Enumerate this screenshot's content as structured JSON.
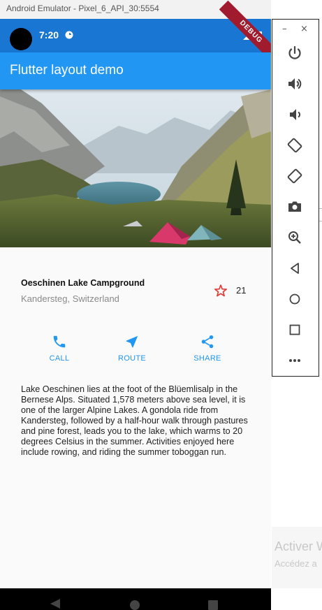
{
  "window": {
    "title": "Android Emulator - Pixel_6_API_30:5554"
  },
  "status_bar": {
    "time": "7:20",
    "debug_banner": "DEBUG"
  },
  "app_bar": {
    "title": "Flutter layout demo"
  },
  "place": {
    "title": "Oeschinen Lake Campground",
    "location": "Kandersteg, Switzerland",
    "favorite_count": "21"
  },
  "actions": [
    {
      "label": "CALL",
      "icon": "phone-icon"
    },
    {
      "label": "ROUTE",
      "icon": "navigation-icon"
    },
    {
      "label": "SHARE",
      "icon": "share-icon"
    }
  ],
  "description": "Lake Oeschinen lies at the foot of the Blüemlisalp in the Bernese Alps. Situated 1,578 meters above sea level, it is one of the larger Alpine Lakes. A gondola ride from Kandersteg, followed by a half-hour walk through pastures and pine forest, leads you to the lake, which warms to 20 degrees Celsius in the summer. Activities enjoyed here include rowing, and riding the summer toboggan run.",
  "emulator_toolbar": {
    "buttons": [
      "power-icon",
      "volume-up-icon",
      "volume-down-icon",
      "rotate-left-icon",
      "rotate-right-icon",
      "camera-icon",
      "zoom-icon",
      "back-icon",
      "home-icon",
      "overview-icon",
      "more-icon"
    ]
  },
  "background": {
    "activation_title": "Activer W",
    "activation_sub": "Accédez a"
  },
  "colors": {
    "primary": "#2196f3",
    "status_bar": "#1976d2",
    "star": "#e53935"
  }
}
